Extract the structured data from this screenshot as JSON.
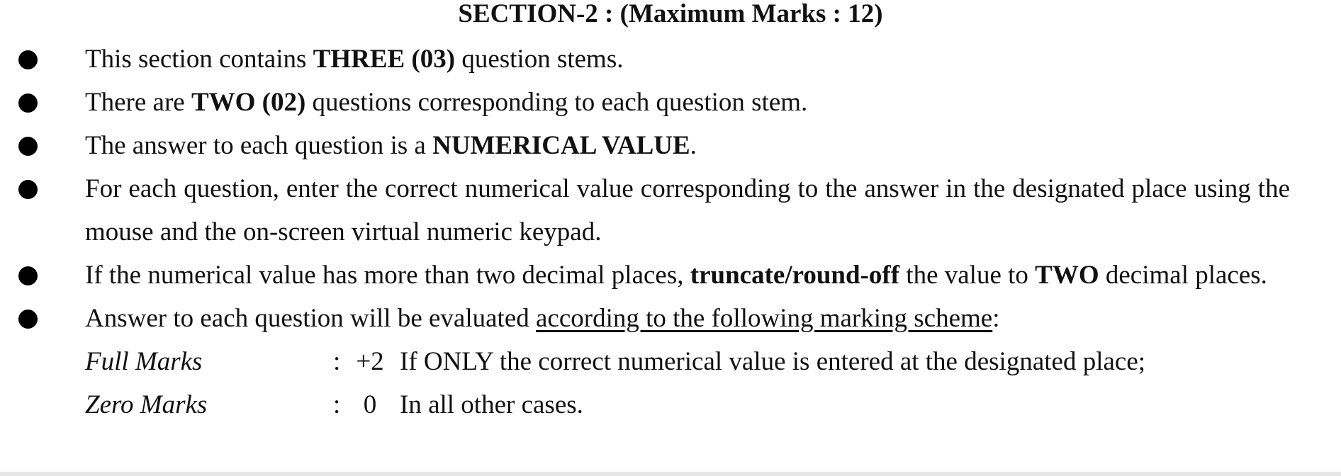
{
  "section_title": "SECTION-2 : (Maximum Marks : 12)",
  "instructions": [
    {
      "parts": [
        {
          "text": "This section contains ",
          "bold": false
        },
        {
          "text": "THREE (03)",
          "bold": true
        },
        {
          "text": " question stems.",
          "bold": false
        }
      ]
    },
    {
      "parts": [
        {
          "text": "There are ",
          "bold": false
        },
        {
          "text": "TWO (02)",
          "bold": true
        },
        {
          "text": " questions corresponding to each question stem.",
          "bold": false
        }
      ]
    },
    {
      "parts": [
        {
          "text": "The answer to each question is a ",
          "bold": false
        },
        {
          "text": "NUMERICAL VALUE",
          "bold": true
        },
        {
          "text": ".",
          "bold": false
        }
      ]
    },
    {
      "parts": [
        {
          "text": "For each question, enter the correct numerical value corresponding to the answer in the designated place using the mouse and the on-screen virtual numeric keypad.",
          "bold": false
        }
      ]
    },
    {
      "parts": [
        {
          "text": "If the numerical value has more than two decimal places, ",
          "bold": false
        },
        {
          "text": "truncate/round-off",
          "bold": true
        },
        {
          "text": " the value to ",
          "bold": false
        },
        {
          "text": "TWO",
          "bold": true
        },
        {
          "text": " decimal places.",
          "bold": false
        }
      ]
    },
    {
      "parts": [
        {
          "text": "Answer to each question will be evaluated ",
          "bold": false
        },
        {
          "text": "according to the following marking scheme",
          "underline": true
        },
        {
          "text": ":",
          "bold": false
        }
      ]
    }
  ],
  "marking_scheme": [
    {
      "label": "Full Marks",
      "colon": ":",
      "value": "+2",
      "description": "If ONLY the correct numerical value is entered at the designated place;"
    },
    {
      "label": "Zero Marks",
      "colon": ":",
      "value": "0",
      "description": "In all other cases."
    }
  ]
}
